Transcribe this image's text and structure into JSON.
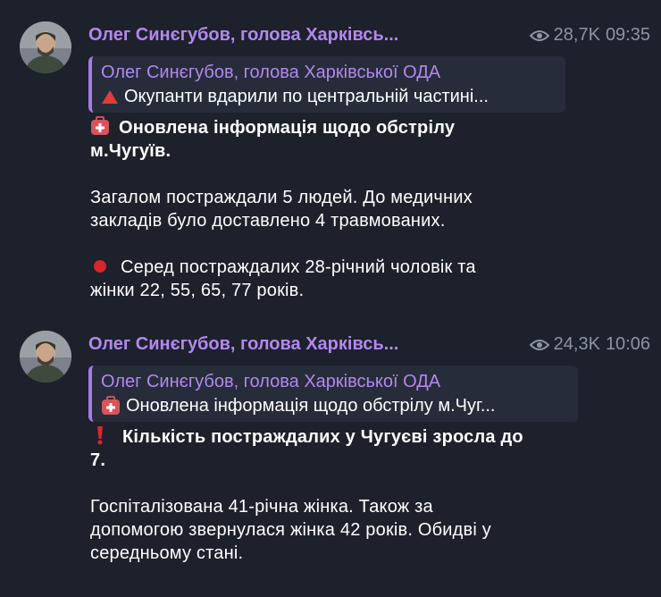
{
  "posts": [
    {
      "author": "Олег Синєгубов, голова Харківсь...",
      "views": "28,7K",
      "time": "09:35",
      "quote": {
        "title": "Олег Синєгубов, голова Харківської ОДА",
        "text": "Окупанти вдарили по центральній частині...",
        "icon": "red-triangle-icon"
      },
      "headline": {
        "icon": "medical-kit-icon",
        "line1": "Оновлена інформація щодо обстрілу",
        "line2": "м.Чугуїв."
      },
      "paragraphs": [
        {
          "line1": "Загалом постраждали 5 людей. До медичних",
          "line2": "закладів було доставлено 4 травмованих."
        }
      ],
      "bullet": {
        "icon": "red-circle-icon",
        "line1": "Серед постраждалих 28-річний чоловік та",
        "line2": "жінки 22, 55, 65, 77 років."
      }
    },
    {
      "author": "Олег Синєгубов, голова Харківсь...",
      "views": "24,3K",
      "time": "10:06",
      "quote": {
        "title": "Олег Синєгубов, голова Харківської ОДА",
        "text": "Оновлена інформація щодо обстрілу м.Чуг...",
        "icon": "medical-kit-icon"
      },
      "headline": {
        "icon": "exclamation-icon",
        "line1": "Кількість постраждалих у Чугуєві зросла до",
        "line2": "7."
      },
      "paragraphs": [
        {
          "line1": "Госпіталізована 41-річна жінка. Також за",
          "line2": "допомогою звернулася жінка 42 років. Обидві у",
          "line3": "середньому стані."
        }
      ]
    }
  ],
  "colors": {
    "background": "#1c212b",
    "accent": "#b388ee",
    "meta": "#8b95a3",
    "quote_bg": "#262c3a"
  }
}
